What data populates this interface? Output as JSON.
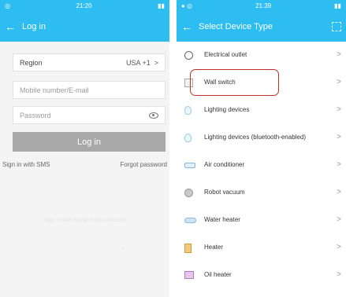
{
  "login_screen": {
    "status_time": "21:20",
    "title": "Log in",
    "region_label": "Region",
    "region_value": "USA +1",
    "phone_placeholder": "Mobile number/E-mail",
    "password_placeholder": "Password",
    "login_button": "Log in",
    "sms_link": "Sign in with SMS",
    "forgot_link": "Forgot password",
    "social_text": "Sign in with social media account"
  },
  "device_screen": {
    "status_time": "21:39",
    "title": "Select Device Type",
    "items": [
      {
        "label": "Electrical outlet",
        "icon": "outlet-icon"
      },
      {
        "label": "Wall switch",
        "icon": "wall-switch-icon"
      },
      {
        "label": "Lighting devices",
        "icon": "light-bulb-icon"
      },
      {
        "label": "Lighting devices (bluetooth-enabled)",
        "icon": "light-bulb-icon"
      },
      {
        "label": "Air conditioner",
        "icon": "air-conditioner-icon"
      },
      {
        "label": "Robot vacuum",
        "icon": "robot-vacuum-icon"
      },
      {
        "label": "Water heater",
        "icon": "water-heater-icon"
      },
      {
        "label": "Heater",
        "icon": "heater-icon"
      },
      {
        "label": "Oil heater",
        "icon": "oil-heater-icon"
      }
    ]
  },
  "colors": {
    "accent": "#2dbdf0",
    "highlight": "#c0302b",
    "button_disabled": "#a8a8a8"
  }
}
